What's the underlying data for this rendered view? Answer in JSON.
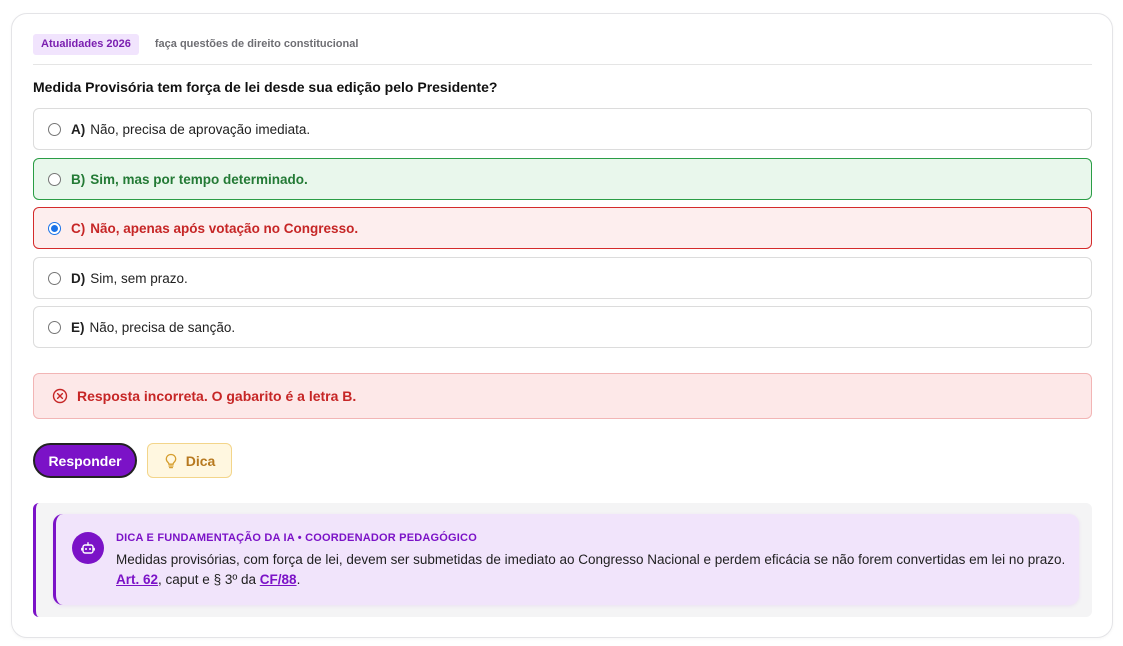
{
  "header": {
    "tag": "Atualidades 2026",
    "subtitle": "faça questões de direito constitucional"
  },
  "question": "Medida Provisória tem força de lei desde sua edição pelo Presidente?",
  "options": [
    {
      "letter": "A)",
      "text": "Não, precisa de aprovação imediata.",
      "state": "normal"
    },
    {
      "letter": "B)",
      "text": "Sim, mas por tempo determinado.",
      "state": "correct"
    },
    {
      "letter": "C)",
      "text": "Não, apenas após votação no Congresso.",
      "state": "wrong-selected"
    },
    {
      "letter": "D)",
      "text": "Sim, sem prazo.",
      "state": "normal"
    },
    {
      "letter": "E)",
      "text": "Não, precisa de sanção.",
      "state": "normal"
    }
  ],
  "feedback": {
    "icon": "x-circle-icon",
    "text": "Resposta incorreta. O gabarito é a letra B."
  },
  "actions": {
    "respond_label": "Responder",
    "hint_label": "Dica",
    "hint_icon": "lightbulb-icon"
  },
  "ai_hint": {
    "title": "DICA E FUNDAMENTAÇÃO DA IA • COORDENADOR PEDAGÓGICO",
    "text_part1": "Medidas provisórias, com força de lei, devem ser submetidas de imediato ao Congresso Nacional e perdem eficácia se não forem convertidas em lei no prazo. ",
    "link1": "Art. 62",
    "text_part2": ", caput e § 3º da ",
    "link2": "CF/88",
    "text_part3": "."
  },
  "colors": {
    "accent": "#7b12c7",
    "correct": "#237a35",
    "wrong": "#c62626",
    "hint": "#b7791f"
  }
}
